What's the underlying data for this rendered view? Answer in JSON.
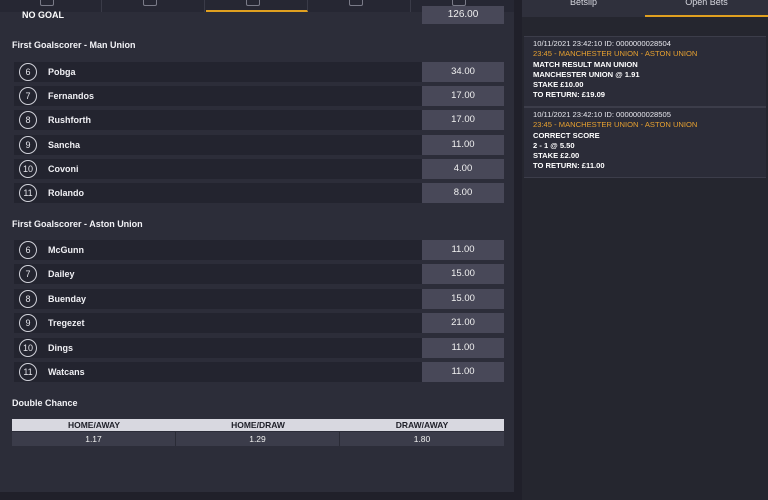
{
  "no_goal": {
    "label": "NO GOAL",
    "odds": "126.00"
  },
  "man_union": {
    "title": "First Goalscorer - Man Union",
    "players": [
      {
        "num": "6",
        "name": "Pobga",
        "odds": "34.00"
      },
      {
        "num": "7",
        "name": "Fernandos",
        "odds": "17.00"
      },
      {
        "num": "8",
        "name": "Rushforth",
        "odds": "17.00"
      },
      {
        "num": "9",
        "name": "Sancha",
        "odds": "11.00"
      },
      {
        "num": "10",
        "name": "Covoni",
        "odds": "4.00"
      },
      {
        "num": "11",
        "name": "Rolando",
        "odds": "8.00"
      }
    ]
  },
  "aston_union": {
    "title": "First Goalscorer - Aston Union",
    "players": [
      {
        "num": "6",
        "name": "McGunn",
        "odds": "11.00"
      },
      {
        "num": "7",
        "name": "Dailey",
        "odds": "15.00"
      },
      {
        "num": "8",
        "name": "Buenday",
        "odds": "15.00"
      },
      {
        "num": "9",
        "name": "Tregezet",
        "odds": "21.00"
      },
      {
        "num": "10",
        "name": "Dings",
        "odds": "11.00"
      },
      {
        "num": "11",
        "name": "Watcans",
        "odds": "11.00"
      }
    ]
  },
  "double_chance": {
    "title": "Double Chance",
    "headers": [
      "HOME/AWAY",
      "HOME/DRAW",
      "DRAW/AWAY"
    ],
    "values": [
      "1.17",
      "1.29",
      "1.80"
    ]
  },
  "right_tabs": [
    "Betslip",
    "Open Bets"
  ],
  "open_bets": [
    {
      "meta": "10/11/2021 23:42:10 ID: 0000000028504",
      "match": "23:45 - MANCHESTER UNION - ASTON UNION",
      "market": "MATCH RESULT MAN UNION",
      "selection": "MANCHESTER UNION @ 1.91",
      "stake": "STAKE £10.00",
      "to_return": "TO RETURN: £19.09"
    },
    {
      "meta": "10/11/2021 23:42:10 ID: 0000000028505",
      "match": "23:45 - MANCHESTER UNION - ASTON UNION",
      "market": "CORRECT SCORE",
      "selection": "2 - 1 @ 5.50",
      "stake": "STAKE £2.00",
      "to_return": "TO RETURN: £11.00"
    }
  ],
  "colors": {
    "accent": "#e0a020",
    "odds_bg": "#484858",
    "row_bg": "#23242f"
  }
}
